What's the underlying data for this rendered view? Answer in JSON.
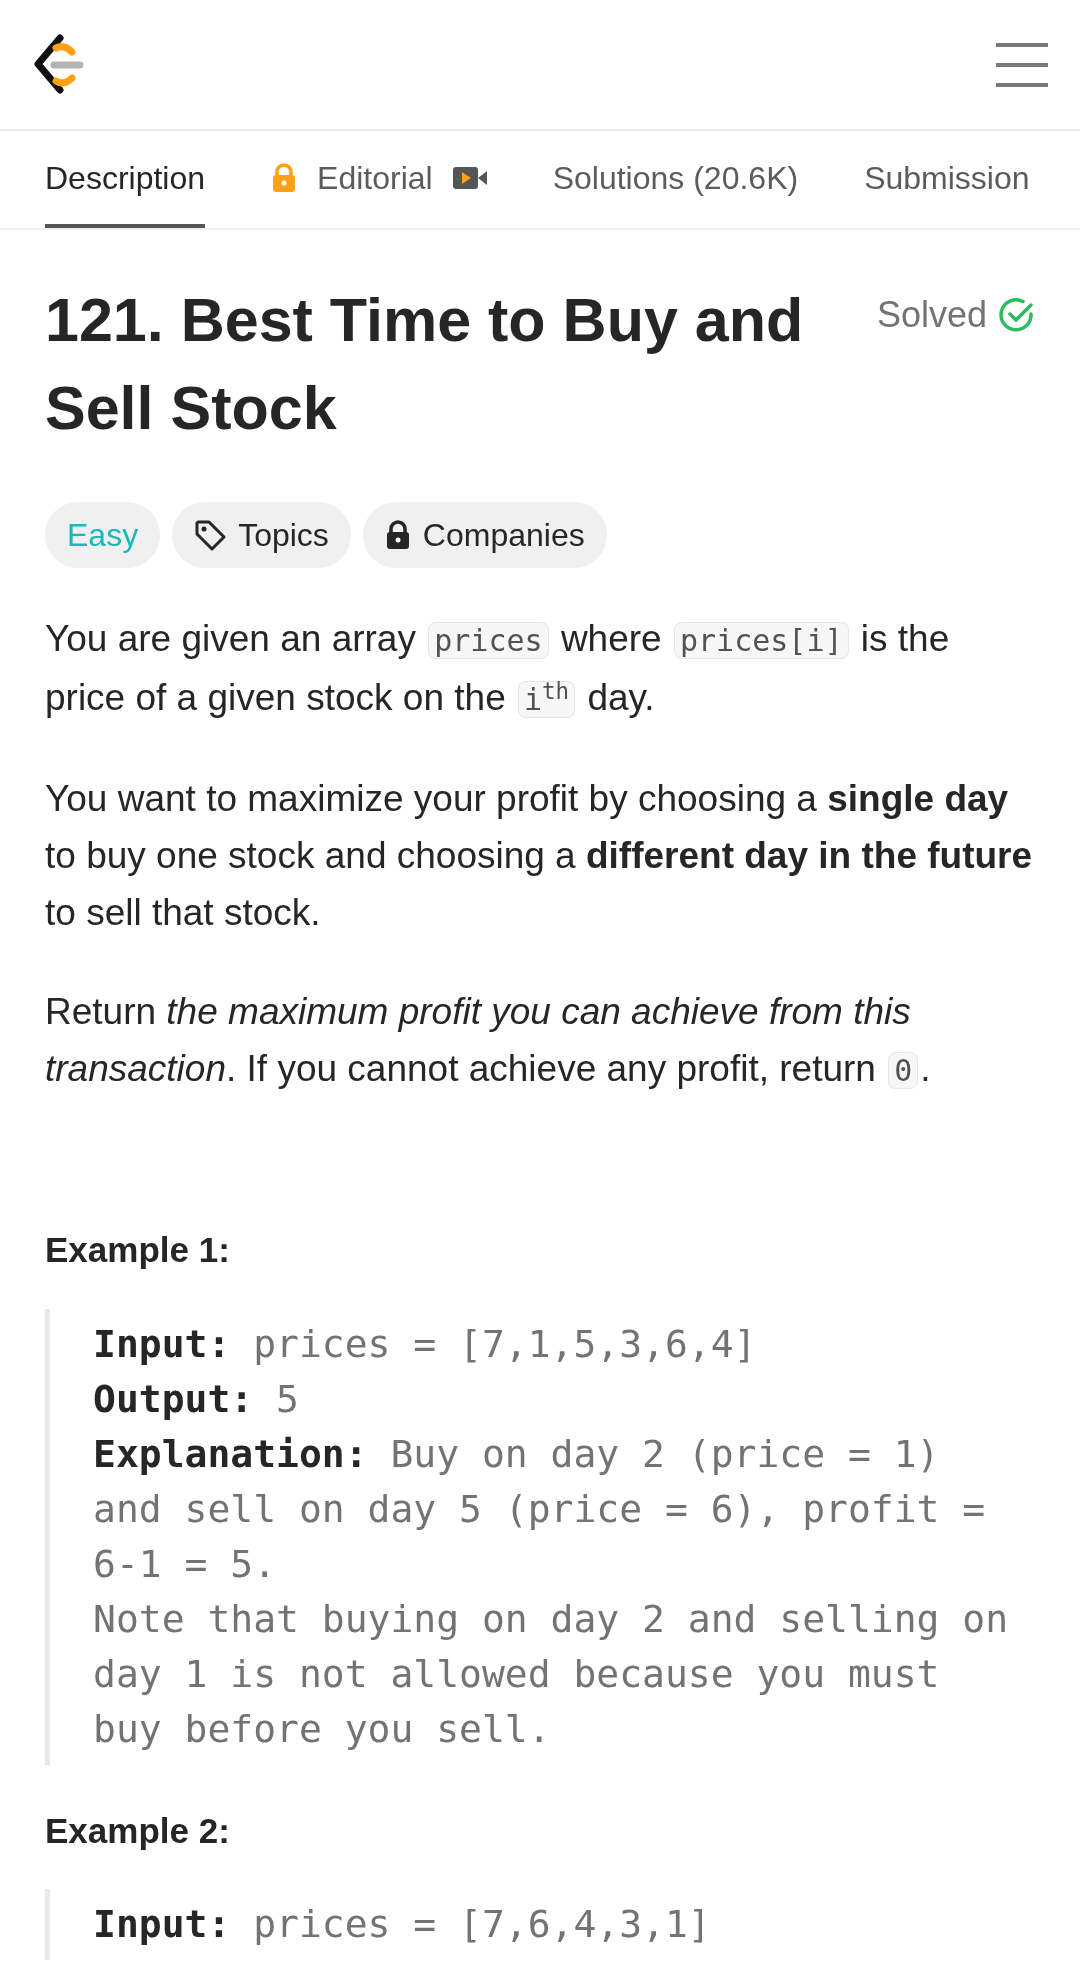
{
  "tabs": [
    {
      "label": "Description",
      "selected": true,
      "locked": false,
      "video": false
    },
    {
      "label": "Editorial",
      "selected": false,
      "locked": true,
      "video": true
    },
    {
      "label": "Solutions (20.6K)",
      "selected": false,
      "locked": false,
      "video": false
    },
    {
      "label": "Submission",
      "selected": false,
      "locked": false,
      "video": false
    }
  ],
  "problem": {
    "title": "121. Best Time to Buy and Sell Stock",
    "status": "Solved",
    "solved": true
  },
  "tags": [
    {
      "kind": "difficulty",
      "label": "Easy"
    },
    {
      "kind": "topics",
      "label": "Topics"
    },
    {
      "kind": "companies",
      "label": "Companies"
    }
  ],
  "description": [
    [
      {
        "kind": "text",
        "text": "You are given an array "
      },
      {
        "kind": "code",
        "text": "prices"
      },
      {
        "kind": "text",
        "text": " where "
      },
      {
        "kind": "code",
        "text": "prices[i]"
      },
      {
        "kind": "text",
        "text": " is the price of a given stock on the "
      },
      {
        "kind": "code",
        "text": "i$^{th}$"
      },
      {
        "kind": "text",
        "text": " day."
      }
    ],
    [
      {
        "kind": "text",
        "text": "You want to maximize your profit by choosing a **single day** to buy one stock and choosing a **different day in the future** to sell that stock."
      }
    ],
    [
      {
        "kind": "text",
        "text": "Return *the maximum profit you can achieve from this transaction*. If you cannot achieve any profit, return "
      },
      {
        "kind": "code",
        "text": "0"
      },
      {
        "kind": "text",
        "text": "."
      }
    ]
  ],
  "examples": [
    {
      "title": "Example 1:",
      "lines": [
        {
          "kind": "field",
          "label": "Input:",
          "value": "prices = [7,1,5,3,6,4]"
        },
        {
          "kind": "field",
          "label": "Output:",
          "value": "5"
        },
        {
          "kind": "field",
          "label": "Explanation:",
          "value": "Buy on day 2 (price = 1) and sell on day 5 (price = 6), profit = 6-1 = 5."
        },
        {
          "kind": "note",
          "value": "Note that buying on day 2 and selling on day 1 is not allowed because you must buy before you sell."
        }
      ]
    },
    {
      "title": "Example 2:",
      "lines": [
        {
          "kind": "field",
          "label": "Input:",
          "value": "prices = [7,6,4,3,1]"
        }
      ]
    }
  ]
}
